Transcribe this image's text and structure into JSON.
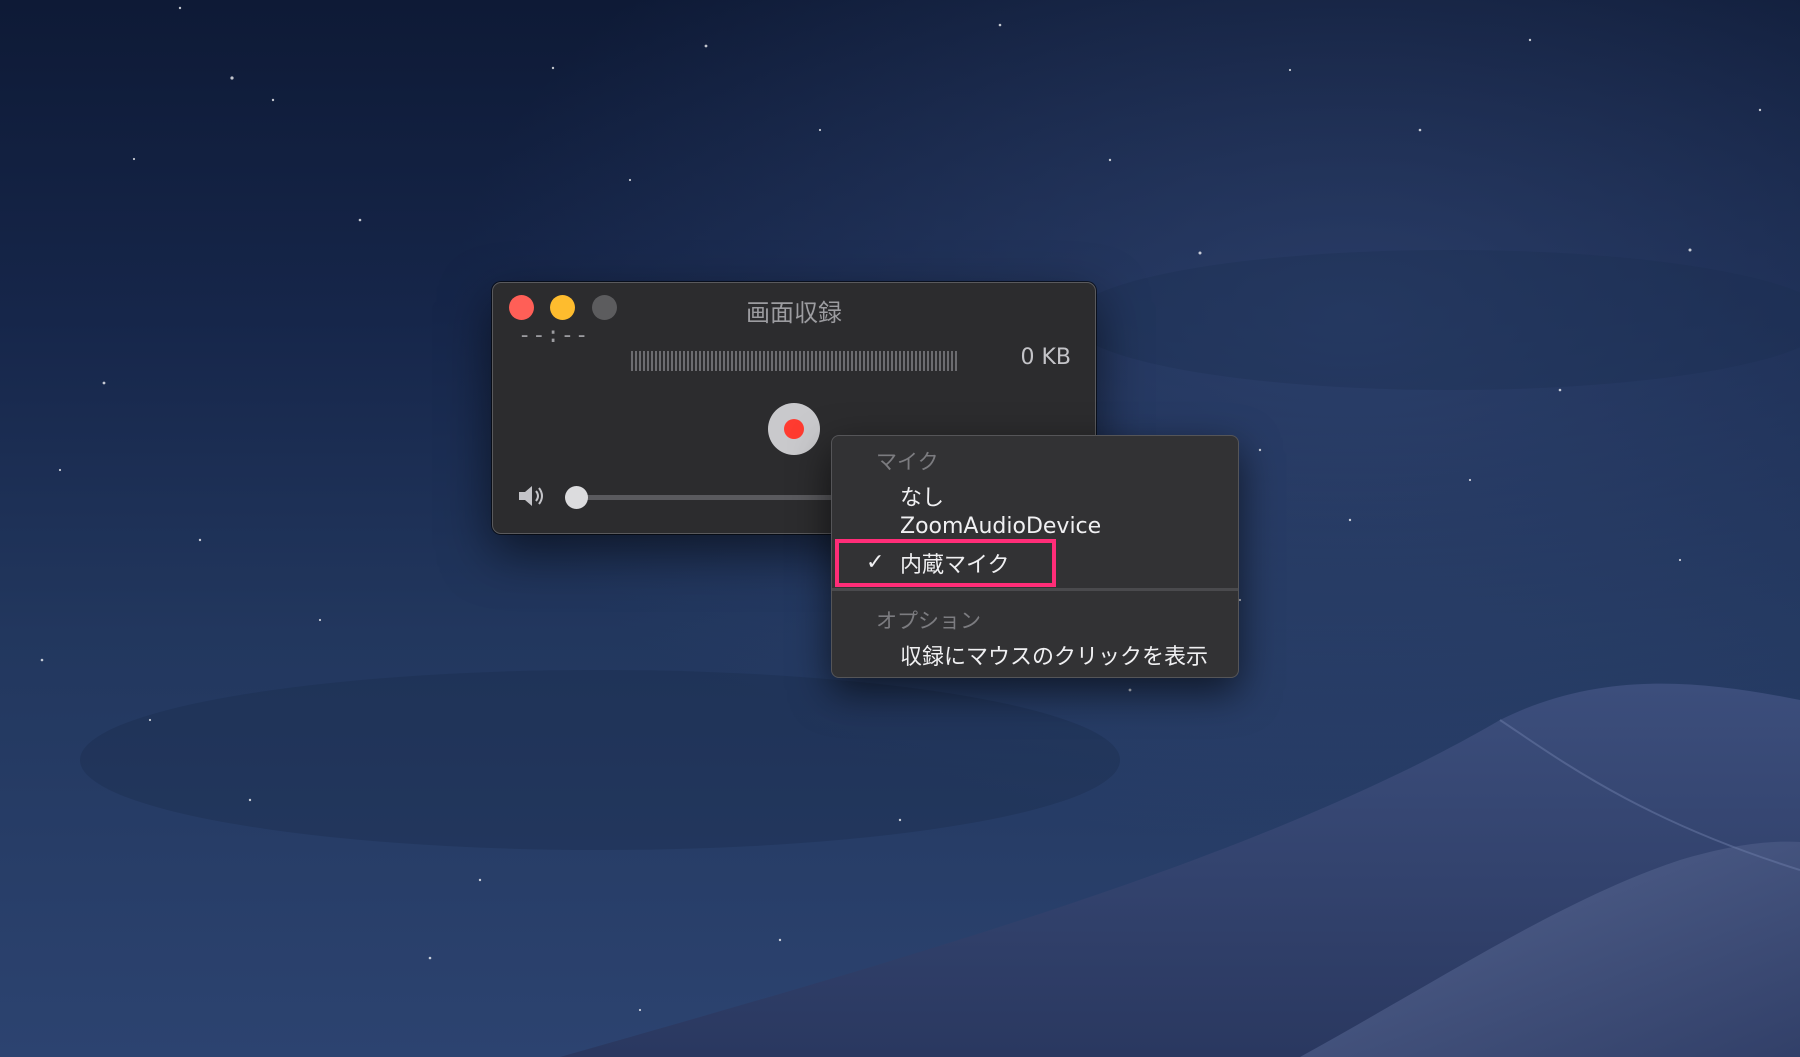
{
  "window": {
    "title": "画面収録",
    "timecode": "--:--",
    "filesize": "0 KB",
    "volume_level": 0
  },
  "menu": {
    "mic_section": "マイク",
    "mic_options": [
      "なし",
      "ZoomAudioDevice",
      "内蔵マイク"
    ],
    "selected_mic": "内蔵マイク",
    "options_section": "オプション",
    "option_items": [
      "収録にマウスのクリックを表示"
    ]
  },
  "colors": {
    "close": "#ff5f57",
    "minimize": "#febc2e",
    "record": "#ff3b30",
    "highlight": "#ff2d78"
  }
}
